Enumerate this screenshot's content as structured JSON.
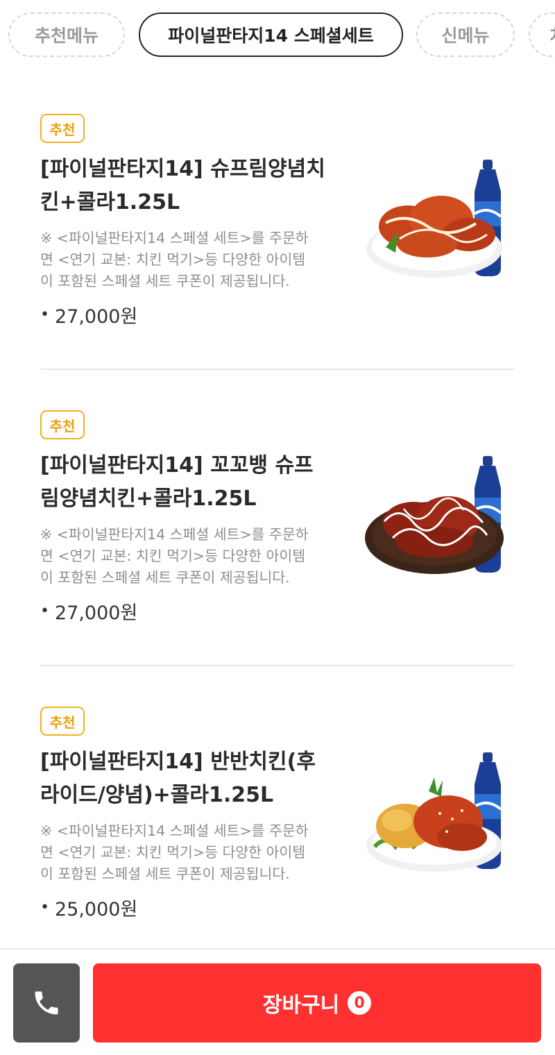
{
  "tabs": [
    {
      "label": "추천메뉴",
      "active": false
    },
    {
      "label": "파이널판타지14 스페셜세트",
      "active": true
    },
    {
      "label": "신메뉴",
      "active": false
    },
    {
      "label": "치",
      "active": false
    }
  ],
  "items": [
    {
      "badge": "추천",
      "name_line1": "[파이널판타지14] 슈프림양념치",
      "name_line2": "킨+콜라1.25L",
      "desc_line1": "※ <파이널판타지14 스페셜 세트>를 주문하",
      "desc_line2": "면 <연기 교본: 치킨 먹기>등 다양한 아이템",
      "desc_line3": "이 포함된 스페셜 세트 쿠폰이 제공됩니다.",
      "bullet": "•",
      "price": "27,000원",
      "image": "supreme-yangnyeom-chicken-with-cola"
    },
    {
      "badge": "추천",
      "name_line1": "[파이널판타지14] 꼬꼬뱅 슈프",
      "name_line2": "림양념치킨+콜라1.25L",
      "desc_line1": "※ <파이널판타지14 스페셜 세트>를 주문하",
      "desc_line2": "면 <연기 교본: 치킨 먹기>등 다양한 아이템",
      "desc_line3": "이 포함된 스페셜 세트 쿠폰이 제공됩니다.",
      "bullet": "•",
      "price": "27,000원",
      "image": "kkokkobaeng-chicken-with-cola"
    },
    {
      "badge": "추천",
      "name_line1": "[파이널판타지14] 반반치킨(후",
      "name_line2": "라이드/양념)+콜라1.25L",
      "desc_line1": "※ <파이널판타지14 스페셜 세트>를 주문하",
      "desc_line2": "면 <연기 교본: 치킨 먹기>등 다양한 아이템",
      "desc_line3": "이 포함된 스페셜 세트 쿠폰이 제공됩니다.",
      "bullet": "•",
      "price": "25,000원",
      "image": "half-half-chicken-with-cola"
    }
  ],
  "bottom_bar": {
    "call_icon": "phone-icon",
    "cart_label": "장바구니",
    "cart_count": "0"
  },
  "colors": {
    "cart_button": "#ff3030",
    "call_button": "#555555",
    "badge": "#f0b21c"
  }
}
